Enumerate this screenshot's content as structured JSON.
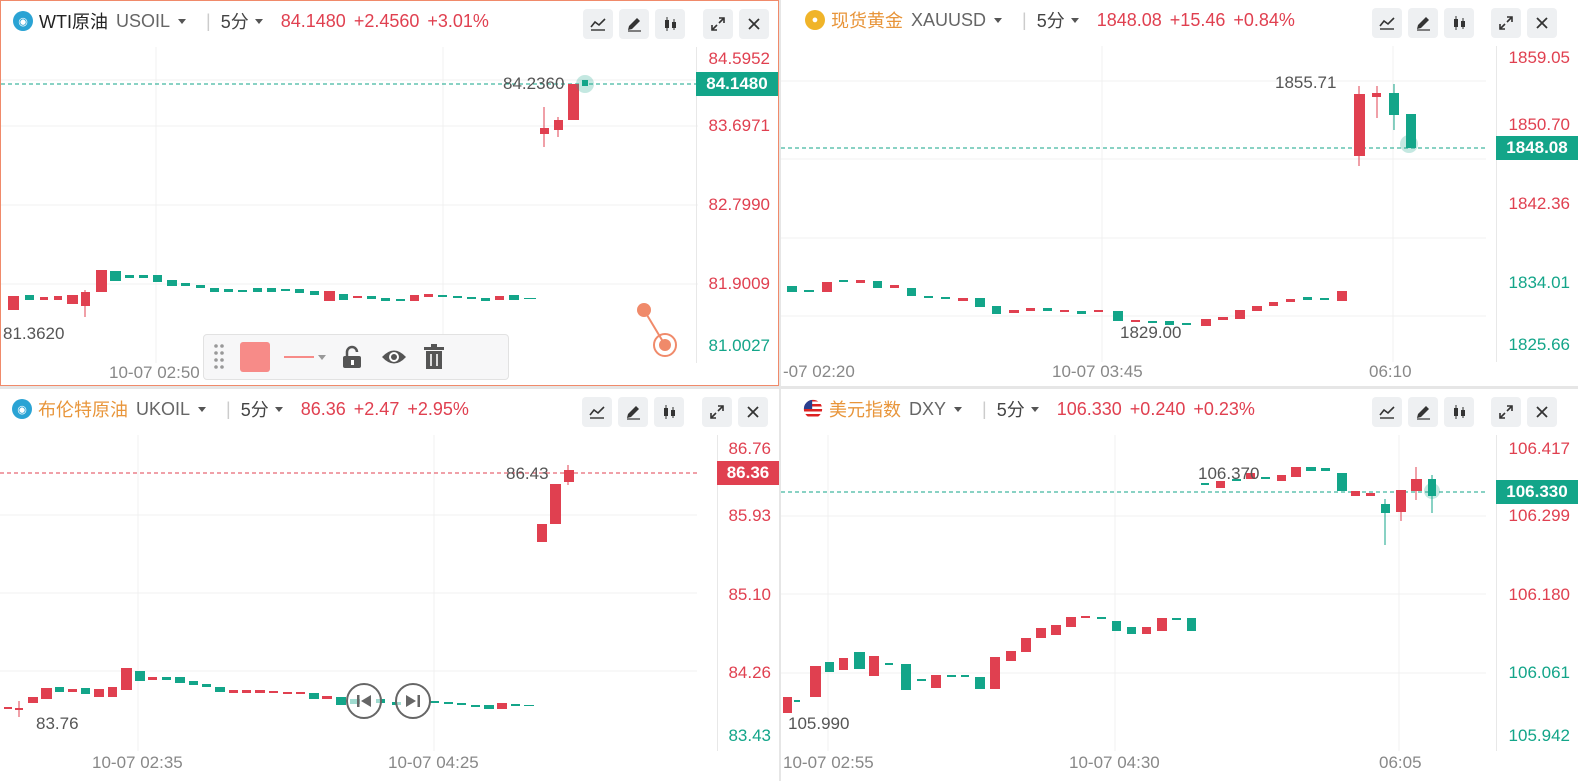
{
  "colors": {
    "up": "#e04050",
    "down": "#13a589",
    "accent": "#f08a6a"
  },
  "panels": [
    {
      "id": "wti",
      "icon": "oil-drop-icon",
      "name": "WTI原油",
      "code": "USOIL",
      "period": "5分",
      "price": "84.1480",
      "change": "+2.4560",
      "pct": "+3.01%",
      "yaxis": [
        "84.5952",
        "83.6971",
        "82.7990",
        "81.9009",
        "81.0027"
      ],
      "current_tag": "84.1480",
      "high_note": "84.2360",
      "low_note": "81.3620",
      "xaxis": [
        "10-07 02:50"
      ]
    },
    {
      "id": "gold",
      "icon": "gold-coin-icon",
      "name": "现货黄金",
      "code": "XAUUSD",
      "period": "5分",
      "price": "1848.08",
      "change": "+15.46",
      "pct": "+0.84%",
      "yaxis": [
        "1859.05",
        "1850.70",
        "1842.36",
        "1834.01",
        "1825.66"
      ],
      "current_tag": "1848.08",
      "high_note": "1855.71",
      "low_note": "1829.00",
      "xaxis": [
        "-07 02:20",
        "10-07 03:45",
        "06:10"
      ]
    },
    {
      "id": "brent",
      "icon": "oil-drop-icon",
      "name": "布伦特原油",
      "code": "UKOIL",
      "period": "5分",
      "price": "86.36",
      "change": "+2.47",
      "pct": "+2.95%",
      "yaxis": [
        "86.76",
        "85.93",
        "85.10",
        "84.26",
        "83.43"
      ],
      "current_tag": "86.36",
      "high_note": "86.43",
      "low_note": "83.76",
      "xaxis": [
        "10-07 02:35",
        "10-07 04:25"
      ]
    },
    {
      "id": "dxy",
      "icon": "us-flag-icon",
      "name": "美元指数",
      "code": "DXY",
      "period": "5分",
      "price": "106.330",
      "change": "+0.240",
      "pct": "+0.23%",
      "yaxis": [
        "106.417",
        "106.299",
        "106.180",
        "106.061",
        "105.942"
      ],
      "current_tag": "106.330",
      "high_note": "106.370",
      "low_note": "105.990",
      "xaxis": [
        "10-07 02:55",
        "10-07 04:30",
        "06:05"
      ]
    }
  ]
}
